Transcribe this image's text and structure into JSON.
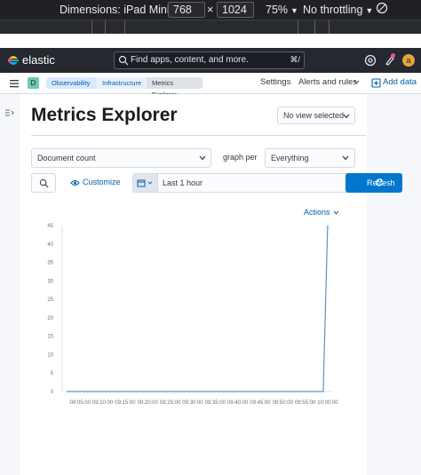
{
  "devtools": {
    "dimensions_label": "Dimensions: iPad Mini",
    "width_value": "768",
    "height_value": "1024",
    "times_symbol": "×",
    "zoom": "75%",
    "throttling": "No throttling"
  },
  "header": {
    "brand": "elastic",
    "search_placeholder": "Find apps, content, and more.",
    "search_shortcut": "⌘/",
    "avatar_initial": "a"
  },
  "subnav": {
    "space_initial": "D",
    "breadcrumbs": [
      "Observability",
      "Infrastructure",
      "Metrics Explorer"
    ],
    "settings": "Settings",
    "alerts_rules": "Alerts and rules",
    "add_data": "Add data"
  },
  "page": {
    "title": "Metrics Explorer",
    "view_selector": "No view selected"
  },
  "controls": {
    "metric": "Document count",
    "graph_per_label": "graph per",
    "group_by": "Everything",
    "customize": "Customize",
    "time_range": "Last 1 hour",
    "refresh": "Refresh",
    "actions": "Actions"
  },
  "colors": {
    "accent": "#0077cc",
    "series": "#6092c0",
    "header_bg": "#25282f"
  },
  "chart_data": {
    "type": "line",
    "title": "",
    "xlabel": "",
    "ylabel": "",
    "ylim": [
      0,
      45
    ],
    "y_ticks": [
      0,
      5,
      10,
      15,
      20,
      25,
      30,
      35,
      40,
      45
    ],
    "x_ticks": [
      "09:05:00",
      "09:10:00",
      "09:15:00",
      "09:20:00",
      "09:25:00",
      "09:30:00",
      "09:35:00",
      "09:40:00",
      "09:45:00",
      "09:50:00",
      "09:55:00",
      "10:00:00"
    ],
    "x": [
      "09:02:00",
      "09:59:00",
      "10:00:00"
    ],
    "values": [
      0,
      0,
      45
    ],
    "grid": false
  }
}
